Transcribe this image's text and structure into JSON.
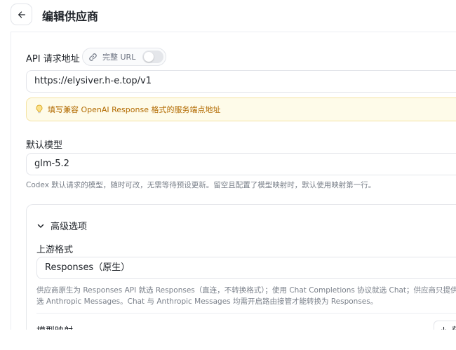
{
  "header": {
    "title": "编辑供应商"
  },
  "api_url": {
    "label": "API 请求地址",
    "full_url_toggle_label": "完整 URL",
    "value": "https://elysiver.h-e.top/v1",
    "hint": "填写兼容 OpenAI Response 格式的服务端点地址"
  },
  "default_model": {
    "label": "默认模型",
    "value": "glm-5.2",
    "help": "Codex 默认请求的模型，随时可改，无需等待预设更新。留空且配置了模型映射时，默认使用映射第一行。"
  },
  "advanced": {
    "title": "高级选项",
    "upstream_format": {
      "label": "上游格式",
      "value": "Responses（原生）",
      "help_line1": "供应商原生为 Responses API 就选 Responses（直连，不转换格式）；使用 Chat Completions 协议就选 Chat；供应商只提供原生",
      "help_line2": "选 Anthropic Messages。Chat 与 Anthropic Messages 均需开启路由接管才能转换为 Responses。"
    },
    "model_mapping": {
      "label": "模型映射",
      "button_label": "获"
    }
  },
  "colors": {
    "accent": "#1f2329",
    "hint_bg": "#fefbe9",
    "hint_text": "#b26a00"
  }
}
